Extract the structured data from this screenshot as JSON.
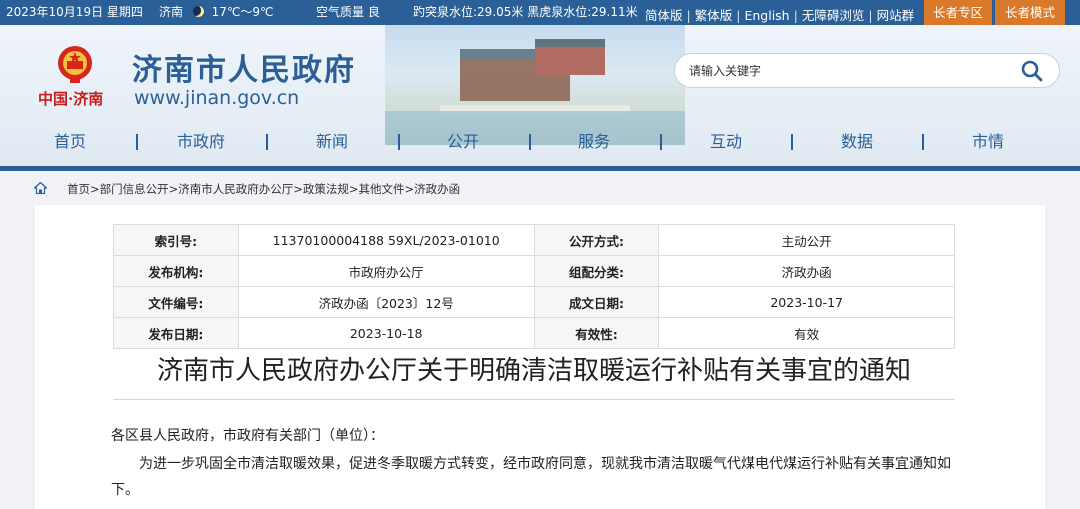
{
  "topbar": {
    "date": "2023年10月19日 星期四",
    "city": "济南",
    "weather_icon": "moon-icon",
    "temperature": "17℃～9℃",
    "air_quality": "空气质量 良",
    "spring_levels": "趵突泉水位:29.05米 黑虎泉水位:29.11米",
    "links": [
      "简体版",
      "繁体版",
      "English",
      "无障碍浏览",
      "网站群"
    ],
    "elder_zone": "长者专区",
    "elder_mode": "长者模式"
  },
  "header": {
    "logo_text": "中国·济南",
    "site_title": "济南市人民政府",
    "site_url": "www.jinan.gov.cn"
  },
  "search": {
    "placeholder": "请输入关键字"
  },
  "nav": {
    "items": [
      "首页",
      "市政府",
      "新闻",
      "公开",
      "服务",
      "互动",
      "数据",
      "市情"
    ]
  },
  "breadcrumb": {
    "text": "首页>部门信息公开>济南市人民政府办公厅>政策法规>其他文件>济政办函"
  },
  "meta": {
    "rows": [
      [
        {
          "k": "索引号:",
          "v": "11370100004188 59XL/2023-01010"
        },
        {
          "k": "公开方式:",
          "v": "主动公开"
        }
      ],
      [
        {
          "k": "发布机构:",
          "v": "市政府办公厅"
        },
        {
          "k": "组配分类:",
          "v": "济政办函"
        }
      ],
      [
        {
          "k": "文件编号:",
          "v": "济政办函〔2023〕12号"
        },
        {
          "k": "成文日期:",
          "v": "2023-10-17"
        }
      ],
      [
        {
          "k": "发布日期:",
          "v": "2023-10-18"
        },
        {
          "k": "有效性:",
          "v": "有效"
        }
      ]
    ]
  },
  "document": {
    "title": "济南市人民政府办公厅关于明确清洁取暖运行补贴有关事宜的通知",
    "salutation": "各区县人民政府，市政府有关部门（单位）：",
    "body": "为进一步巩固全市清洁取暖效果，促进冬季取暖方式转变，经市政府同意，现就我市清洁取暖气代煤电代煤运行补贴有关事宜通知如下。"
  },
  "colors": {
    "brand_blue": "#2a5f97",
    "elder_orange": "#d97a2b",
    "logo_red": "#c91b1b"
  }
}
